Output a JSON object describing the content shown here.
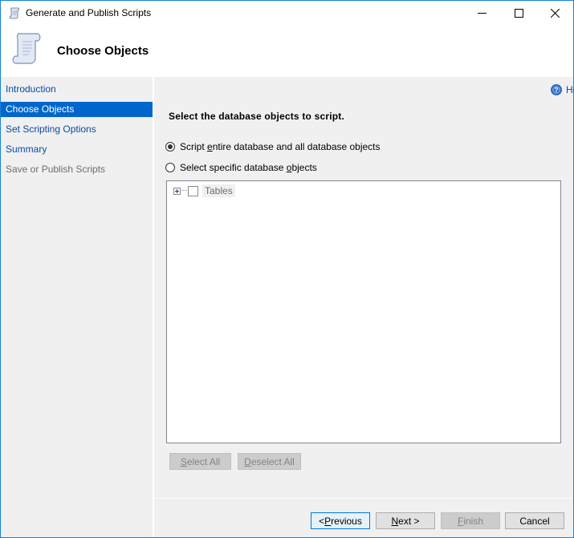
{
  "window": {
    "title": "Generate and Publish Scripts",
    "controls": {
      "minimize": "minimize",
      "maximize": "maximize",
      "close": "close"
    }
  },
  "header": {
    "title": "Choose Objects",
    "icon": "scroll-icon"
  },
  "sidebar": {
    "items": [
      {
        "label": "Introduction",
        "state": "normal"
      },
      {
        "label": "Choose Objects",
        "state": "active"
      },
      {
        "label": "Set Scripting Options",
        "state": "normal"
      },
      {
        "label": "Summary",
        "state": "normal"
      },
      {
        "label": "Save or Publish Scripts",
        "state": "disabled"
      }
    ]
  },
  "main": {
    "help_label": "Help",
    "instruction": "Select the database objects to script.",
    "options": [
      {
        "pre": "Script ",
        "accel": "e",
        "post": "ntire database and all database objects",
        "checked": true
      },
      {
        "pre": "Select specific database ",
        "accel": "o",
        "post": "bjects",
        "checked": false
      }
    ],
    "tree": {
      "nodes": [
        {
          "label": "Tables",
          "expanded": false,
          "checked": false
        }
      ]
    },
    "select_all": {
      "accel": "S",
      "rest": "elect All",
      "enabled": false
    },
    "deselect_all": {
      "accel": "D",
      "rest": "eselect All",
      "enabled": false
    }
  },
  "footer": {
    "previous": {
      "pre": "< ",
      "accel": "P",
      "post": "revious",
      "enabled": true
    },
    "next": {
      "pre": "",
      "accel": "N",
      "post": "ext >",
      "enabled": true
    },
    "finish": {
      "pre": "",
      "accel": "F",
      "post": "inish",
      "enabled": false
    },
    "cancel": {
      "label": "Cancel",
      "enabled": true
    }
  },
  "colors": {
    "accent": "#0066cc",
    "link": "#0a4a9e",
    "window_border": "#1883d7",
    "panel_bg": "#f0f0f0"
  }
}
